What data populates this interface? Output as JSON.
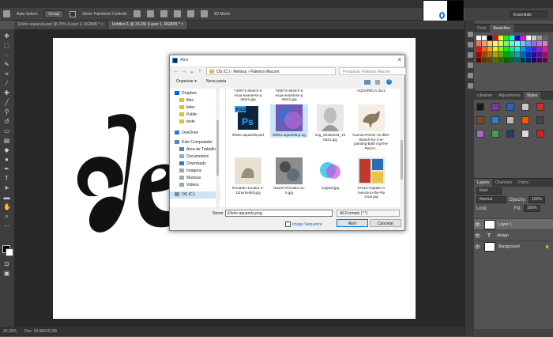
{
  "menubar": {},
  "options_bar": {
    "auto_select_label": "Auto-Select:",
    "auto_select_value": "Group",
    "transform_label": "Show Transform Controls",
    "mode_label": "3D Mode:"
  },
  "workspace": {
    "label": "Essentials"
  },
  "document_tabs": [
    {
      "label": "Efeito aquarela.psd @ 25% (Layer 2, RGB/8) *",
      "close": "×"
    },
    {
      "label": "Untitled-1 @ 33,3% (Layer 1, RGB/8) *",
      "close": "×"
    }
  ],
  "status_bar": {
    "zoom": "33,33%",
    "doc": "Doc: 34,9M/15,0M"
  },
  "swatches_panel": {
    "tabs": [
      "Color",
      "Swatches"
    ]
  },
  "swatch_colors": [
    "#ffffff",
    "#f2f2f2",
    "#000000",
    "#ff0000",
    "#ffff00",
    "#00ff00",
    "#00ffff",
    "#0000ff",
    "#ff00ff",
    "#ffffff",
    "#cccccc",
    "#999999",
    "#666666",
    "#ff6666",
    "#ff9966",
    "#ffcc66",
    "#ffff66",
    "#ccff66",
    "#66ff66",
    "#66ffcc",
    "#66ffff",
    "#66ccff",
    "#6699ff",
    "#9966ff",
    "#cc66ff",
    "#ff66cc",
    "#ee1111",
    "#ee6611",
    "#eeaa11",
    "#eeee11",
    "#99ee11",
    "#11ee11",
    "#11ee99",
    "#11eeee",
    "#1199ee",
    "#1155ee",
    "#5511ee",
    "#9911ee",
    "#ee11aa",
    "#aa0000",
    "#aa4400",
    "#aa7700",
    "#aaaa00",
    "#66aa00",
    "#00aa00",
    "#00aa66",
    "#00aaaa",
    "#0066aa",
    "#0033aa",
    "#3300aa",
    "#6600aa",
    "#aa0077",
    "#660000",
    "#663300",
    "#664400",
    "#666600",
    "#336600",
    "#006600",
    "#006633",
    "#006666",
    "#003366",
    "#002266",
    "#220066",
    "#440066",
    "#660044"
  ],
  "styles_panel": {
    "tabs": [
      "Libraries",
      "Adjustments",
      "Styles"
    ]
  },
  "style_swatches": [
    "#1a1a1a",
    "#7a3b9c",
    "#2466c9",
    "#c7c7c7",
    "#d62828",
    "#8b4513",
    "#2a7fd4",
    "#bbbbbb",
    "#ff5500",
    "#444444",
    "#aa66cc",
    "#3fa34d",
    "#1c3d6e",
    "#dddddd",
    "#cc2222"
  ],
  "layers_panel": {
    "tabs": [
      "Layers",
      "Channels",
      "Paths"
    ],
    "filter": "Kind",
    "blend_mode": "Normal",
    "opacity_label": "Opacity:",
    "opacity_value": "100%",
    "lock_label": "Lock:",
    "fill_label": "Fill:",
    "fill_value": "100%",
    "layers": [
      {
        "name": "Layer 1",
        "thumb": "",
        "italic": false,
        "lock": ""
      },
      {
        "name": "design",
        "thumb": "T",
        "italic": false,
        "lock": ""
      },
      {
        "name": "Background",
        "thumb": "",
        "italic": true,
        "lock": "🔒"
      }
    ]
  },
  "dialog": {
    "title": "Abrir",
    "close": "×",
    "breadcrumb": "OS (C:)  ›  Melissa  ›  Palestra Wacom",
    "search_placeholder": "Pesquisar Palestra Wacom",
    "organize": "Organizar ▾",
    "new_folder": "Nova pasta",
    "nav_items": [
      {
        "label": "Dropbox",
        "icon": "#0061fe"
      },
      {
        "label": "files",
        "icon": "#e6b93f"
      },
      {
        "label": "leitor",
        "icon": "#e6b93f"
      },
      {
        "label": "Public",
        "icon": "#e6b93f"
      },
      {
        "label": "teste",
        "icon": "#e6b93f"
      },
      {
        "label": "OneDrive",
        "icon": "#2b7cd3"
      },
      {
        "label": "Este Computador",
        "icon": "#4f86c6"
      },
      {
        "label": "Área de Trabalho",
        "icon": "#4f86c6"
      },
      {
        "label": "Documentos",
        "icon": "#9aa9b8"
      },
      {
        "label": "Downloads",
        "icon": "#2b7cd3"
      },
      {
        "label": "Imagens",
        "icon": "#9aa9b8"
      },
      {
        "label": "Músicas",
        "icon": "#9aa9b8"
      },
      {
        "label": "Vídeos",
        "icon": "#9aa9b8"
      },
      {
        "label": "OS (C:)",
        "icon": "#7a8a99"
      }
    ],
    "top_row": [
      "749071-Sketch-K enya-seamless-p attern.jpg",
      "749073-Sketch-K enya-seamless-p attern.jpg",
      "",
      "AQUARELA.docx"
    ],
    "files": [
      {
        "name": "Efeito aquarela.psd",
        "kind": "psd"
      },
      {
        "name": "Efeito-aquarela.p ng",
        "kind": "watercolor"
      },
      {
        "name": "img_20150123_16 5531.jpg",
        "kind": "sketch"
      },
      {
        "name": "Kuzma-Petrov-Vo dkin-Sketch-for-t he-painting-Bath ing-the-Red-H...",
        "kind": "horse"
      },
      {
        "name": "leonardo-11natur e-11horse550.jpg",
        "kind": "leonardo"
      },
      {
        "name": "Naomi-Chi-tatto oo-5.jpg",
        "kind": "tattoo"
      },
      {
        "name": "original.jpg",
        "kind": "splash"
      },
      {
        "name": "ST114-Captain-A merica-to-the-Re scue.jpg",
        "kind": "comic"
      }
    ],
    "filename_label": "Nome:",
    "filename_value": "Efeito-aquarela.png",
    "format_value": "All Formats (*.*)",
    "image_sequence": "Image Sequence",
    "open_button": "Abrir",
    "cancel_button": "Cancelar"
  }
}
